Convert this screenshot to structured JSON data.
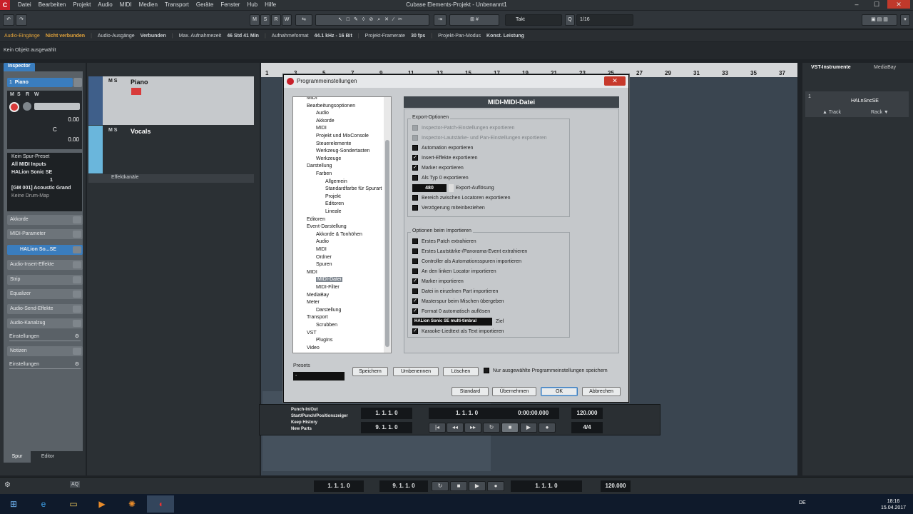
{
  "app": {
    "title": "Cubase Elements-Projekt - Unbenannt1",
    "menu": [
      "Datei",
      "Bearbeiten",
      "Projekt",
      "Audio",
      "MIDI",
      "Medien",
      "Transport",
      "Geräte",
      "Fenster",
      "Hub",
      "Hilfe"
    ],
    "win_min": "–",
    "win_max": "☐",
    "win_close": "✕"
  },
  "toolbar": {
    "undo": "↶",
    "redo": "↷",
    "m": "M",
    "s": "S",
    "r": "R",
    "w": "W",
    "snap_label": "Takt",
    "quantize_label": "Q",
    "quantize": "1/16"
  },
  "info": {
    "in_label": "Audio-Eingänge",
    "in_val": "Nicht verbunden",
    "out_label": "Audio-Ausgänge",
    "out_val": "Verbunden",
    "rec_label": "Max. Aufnahmezeit",
    "rec_val": "46 Std 41 Min",
    "fmt_label": "Aufnahmeformat",
    "fmt_val": "44.1 kHz - 16 Bit",
    "fps_label": "Projekt-Framerate",
    "fps_val": "30 fps",
    "pan_label": "Projekt-Pan-Modus",
    "pan_val": "Konst. Leistung"
  },
  "status": "Kein Objekt ausgewählt",
  "inspector": {
    "tab": "Inspector",
    "track_no": "1",
    "track_name": "Piano",
    "m": "M",
    "s": "S",
    "r": "R",
    "w": "W",
    "val1": "0.00",
    "val2": "0.00",
    "c": "C",
    "preset": "Kein Spur-Preset",
    "input": "All MIDI Inputs",
    "output": "HALion Sonic SE",
    "channel": "1",
    "program": "[GM 001] Acoustic Grand",
    "drum": "Keine Drum-Map",
    "sections": [
      "Akkorde",
      "MIDI-Parameter",
      "HALion So...SE",
      "Audio-Insert-Effekte",
      "Strip",
      "Equalizer",
      "Audio-Send-Effekte",
      "Audio-Kanalzug",
      "Einstellungen",
      "Notizen",
      "Einstellungen"
    ],
    "tab_spur": "Spur",
    "tab_editor": "Editor"
  },
  "tracks": {
    "t1": "Piano",
    "t2": "Vocals",
    "fx": "Effektkanäle",
    "m": "M",
    "s": "S",
    "r": "R",
    "w": "W",
    "e": "e"
  },
  "ruler": [
    "1",
    "3",
    "5",
    "7",
    "9",
    "11",
    "13",
    "15",
    "17",
    "19",
    "21",
    "23",
    "25",
    "27",
    "29",
    "31",
    "33",
    "35",
    "37"
  ],
  "vst": {
    "tab1": "VST-Instrumente",
    "tab2": "MediaBay",
    "slot": "1",
    "inst": "HALnSncSE",
    "track": "▲ Track",
    "rack": "Rack ▼"
  },
  "dialog": {
    "title": "Programmeinstellungen",
    "panel_title": "MIDI-MIDI-Datei",
    "tree": [
      "MIDI",
      "Bearbeitungsoptionen",
      "Audio",
      "Akkorde",
      "MIDI",
      "Projekt und MixConsole",
      "Steuerelemente",
      "Werkzeug-Sondertasten",
      "Werkzeuge",
      "Darstellung",
      "Farben",
      "Allgemein",
      "Standardfarbe für Spurart",
      "Projekt",
      "Editoren",
      "Lineale",
      "Editoren",
      "Event-Darstellung",
      "Akkorde & Tonhöhen",
      "Audio",
      "MIDI",
      "Ordner",
      "Spuren",
      "MIDI",
      "MIDI-Datei",
      "MIDI-Filter",
      "MediaBay",
      "Meter",
      "Darstellung",
      "Transport",
      "Scrubben",
      "VST",
      "PlugIns",
      "Video"
    ],
    "export_group": "Export-Optionen",
    "export": [
      "Inspector-Patch-Einstellungen exportieren",
      "Inspector-Lautstärke- und Pan-Einstellungen exportieren",
      "Automation exportieren",
      "Insert-Effekte exportieren",
      "Marker exportieren",
      "Als Typ 0 exportieren",
      "Export-Auflösung",
      "Bereich zwischen Locatoren exportieren",
      "Verzögerung miteinbeziehen"
    ],
    "resolution": "480",
    "import_group": "Optionen beim Importieren",
    "import": [
      "Erstes Patch extrahieren",
      "Erstes Lautstärke-/Panorama-Event extrahieren",
      "Controller als Automationsspuren importieren",
      "An den linken Locator importieren",
      "Marker importieren",
      "Datei in einzelnen Part importieren",
      "Masterspur beim Mischen übergeben",
      "Format 0 automatisch auflösen",
      "Ziel",
      "Karaoke-Liedtext als Text importieren"
    ],
    "target": "HALion Sonic SE multi-timbral",
    "presets_label": "Presets",
    "preset_val": "-",
    "save": "Speichern",
    "rename": "Umbenennen",
    "delete": "Löschen",
    "only_selected": "Nur ausgewählte Programmeinstellungen speichern",
    "standard": "Standard",
    "apply": "Übernehmen",
    "ok": "OK",
    "cancel": "Abbrechen"
  },
  "transport": {
    "items": [
      "Punch-In/Out",
      "Start/Punch/Positionszeiger",
      "Keep History",
      "New Parts"
    ],
    "left": "1. 1. 1.   0",
    "right": "9. 1. 1.   0",
    "pos": "1. 1. 1.   0",
    "time": "0:00:00.000",
    "tempo": "120.000",
    "sig": "4/4"
  },
  "bottom": {
    "left": "1. 1. 1.   0",
    "right": "9. 1. 1.   0",
    "pos": "1. 1. 1.   0",
    "tempo": "120.000",
    "aq": "AQ"
  },
  "taskbar": {
    "lang": "DE",
    "time": "18:16",
    "date": "15.04.2017"
  }
}
